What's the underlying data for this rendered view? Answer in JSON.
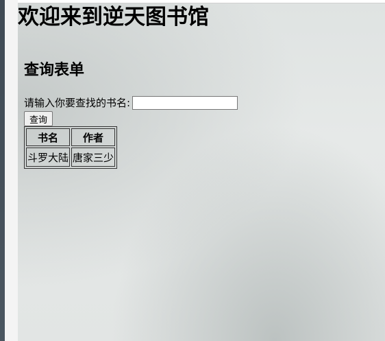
{
  "page": {
    "title": "欢迎来到逆天图书馆",
    "form_title": "查询表单"
  },
  "search": {
    "label": "请输入你要查找的书名:",
    "value": "",
    "button_label": "查询"
  },
  "results": {
    "headers": [
      "书名",
      "作者"
    ],
    "rows": [
      [
        "斗罗大陆",
        "唐家三少"
      ]
    ]
  }
}
